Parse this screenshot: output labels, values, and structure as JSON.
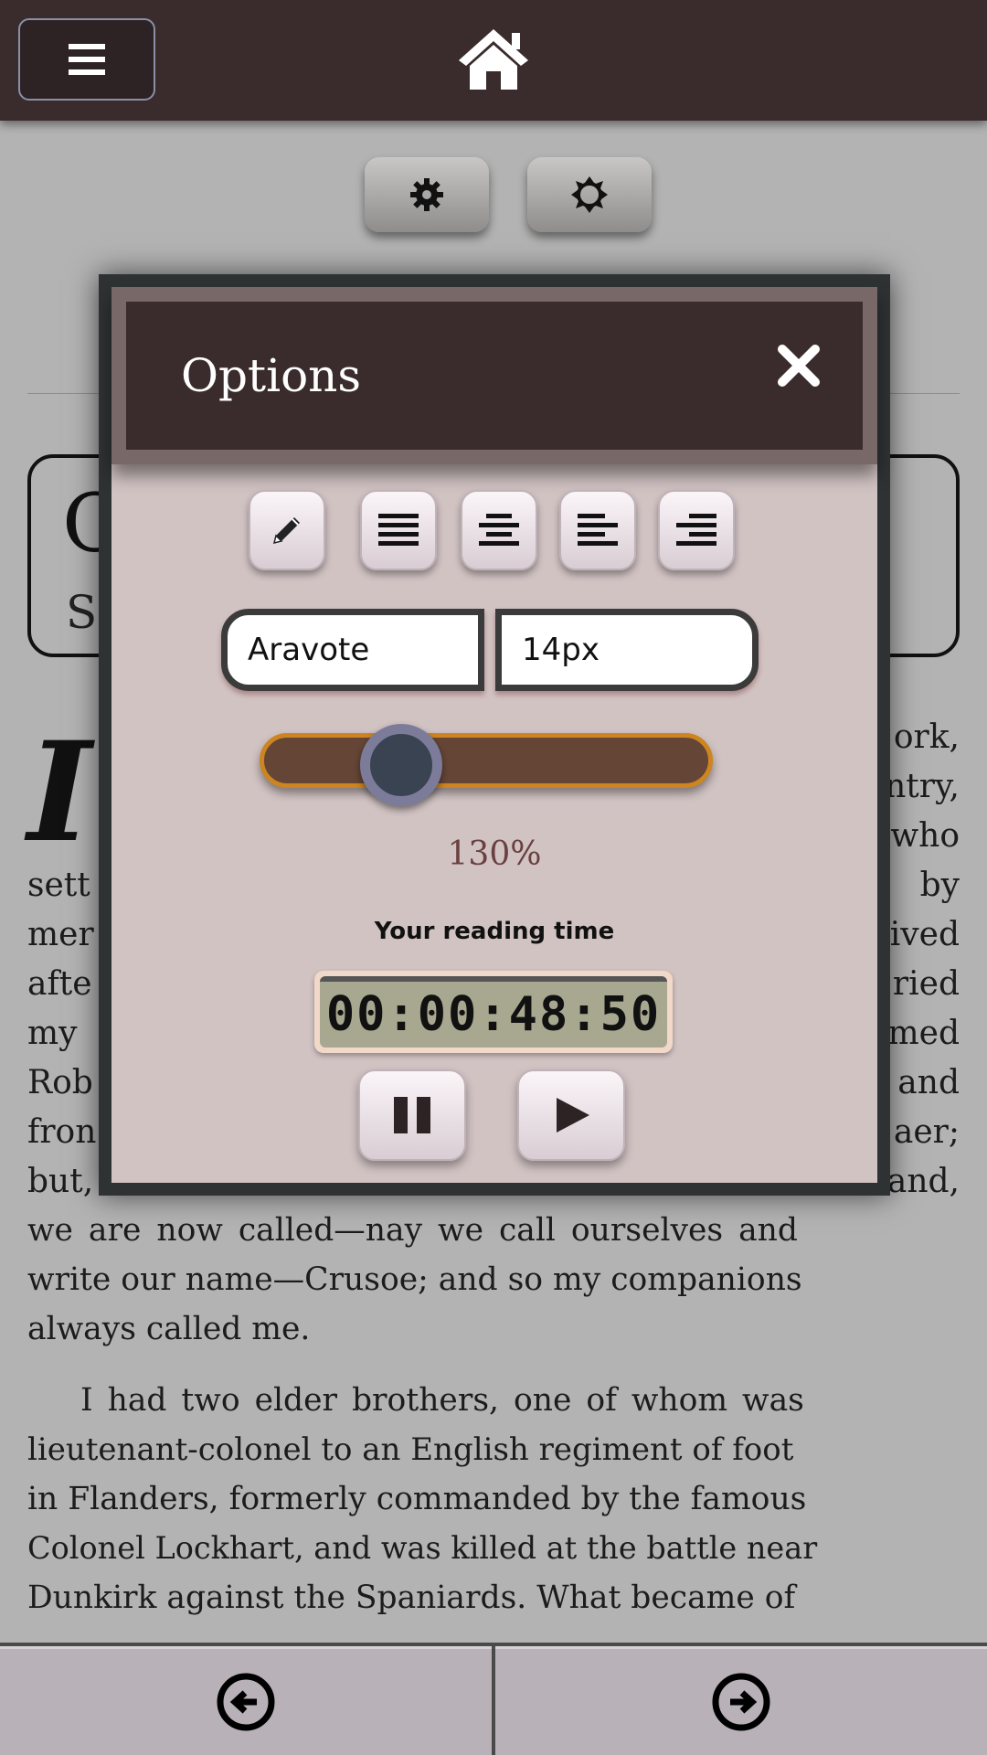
{
  "header": {
    "menu_icon": "hamburger-icon",
    "home_icon": "home-icon"
  },
  "toolbar": {
    "settings_icon": "gear-icon",
    "brightness_icon": "brightness-icon"
  },
  "book": {
    "chapter_initial": "C",
    "chapter_sub": "ST",
    "dropcap": "I",
    "lines_partial": [
      {
        "left": "",
        "right": "ork,"
      },
      {
        "left": "",
        "right": "ntry,"
      },
      {
        "left": "",
        "right": "who"
      },
      {
        "left": "sett",
        "right": "by"
      },
      {
        "left": "mer",
        "right": "ived"
      },
      {
        "left": "afte",
        "right": "ried"
      },
      {
        "left": "my",
        "right": "med"
      },
      {
        "left": "Rob",
        "right": "and"
      },
      {
        "left": "fron",
        "right": "aer;"
      },
      {
        "left": "but,",
        "right": "and,"
      }
    ],
    "lines_full": [
      "we are now called—nay we call ourselves and",
      "write our name—Crusoe; and so my companions",
      "always called me.",
      "I had two elder brothers, one of whom was",
      "lieutenant-colonel to an English regiment of foot",
      "in Flanders, formerly commanded by the famous",
      "Colonel Lockhart, and was killed at the battle near",
      "Dunkirk against the Spaniards. What became of"
    ]
  },
  "options": {
    "title": "Options",
    "close_icon": "close-icon",
    "format_buttons": [
      {
        "name": "edit-button",
        "icon": "pencil-icon"
      },
      {
        "name": "justify-button",
        "icon": "align-justify-icon"
      },
      {
        "name": "align-center-button",
        "icon": "align-center-icon"
      },
      {
        "name": "align-left-button",
        "icon": "align-left-icon"
      },
      {
        "name": "align-right-button",
        "icon": "align-right-icon"
      }
    ],
    "font_family": "Aravote",
    "font_size": "14px",
    "zoom_value": 0.27,
    "zoom_label": "130%",
    "reading_time_label": "Your reading time",
    "reading_time": "00:00:48:50",
    "pause_icon": "pause-icon",
    "play_icon": "play-icon"
  },
  "nav": {
    "prev_icon": "arrow-left-circle-icon",
    "next_icon": "arrow-right-circle-icon"
  },
  "colors": {
    "header_bg": "#3a2c2d",
    "dialog_bg": "#d2c3c3",
    "slider_track": "#654536",
    "slider_border": "#cc8520",
    "accent_text": "#6a4040"
  }
}
